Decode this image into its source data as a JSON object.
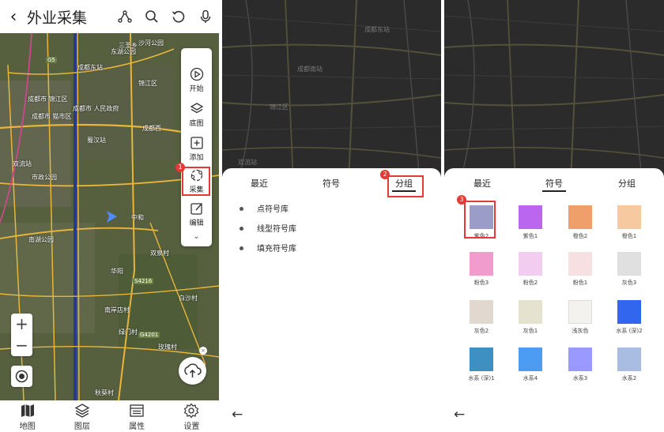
{
  "panel1": {
    "title": "外业采集",
    "map_labels": [
      "东湖公园",
      "沙河公园",
      "成都东站",
      "成都市 人民政府",
      "成都市 锦江区",
      "成都市 猫市区",
      "双流站",
      "市政公园",
      "南湖公园",
      "中和",
      "双泉村",
      "华阳",
      "白沙村",
      "三圣乡",
      "玫瑰村",
      "南岸店村",
      "秋葵村",
      "绿门村",
      "锦江区",
      "成都西",
      "蜀汉站"
    ],
    "road_tags": [
      "G5",
      "S4216",
      "G4201"
    ],
    "tools": [
      "开始",
      "底图",
      "添加",
      "采集",
      "编辑"
    ],
    "badge": "1",
    "zoom_in": "+",
    "zoom_out": "−",
    "close": "×",
    "nav": [
      "地图",
      "图层",
      "属性",
      "设置"
    ]
  },
  "panel2": {
    "tabs": [
      "最近",
      "符号",
      "分组"
    ],
    "active_tab": "分组",
    "badge": "2",
    "libraries": [
      "点符号库",
      "线型符号库",
      "填充符号库"
    ],
    "back": "←",
    "map_labels": [
      "成都东站",
      "成都南站",
      "锦江区",
      "双流站"
    ]
  },
  "panel3": {
    "tabs": [
      "最近",
      "符号",
      "分组"
    ],
    "active_tab": "符号",
    "badge": "3",
    "back": "←",
    "swatches": [
      {
        "name": "紫色2",
        "color": "#9c9cc8"
      },
      {
        "name": "紫色1",
        "color": "#bb66ee"
      },
      {
        "name": "橙色2",
        "color": "#ef9f6a"
      },
      {
        "name": "橙色1",
        "color": "#f6c9a0"
      },
      {
        "name": "粉色3",
        "color": "#f09ccc"
      },
      {
        "name": "粉色2",
        "color": "#f3cdf0"
      },
      {
        "name": "粉色1",
        "color": "#f6e0e2"
      },
      {
        "name": "灰色3",
        "color": "#e0e0e0"
      },
      {
        "name": "灰色2",
        "color": "#e1d9d0"
      },
      {
        "name": "灰色1",
        "color": "#e6e2d0"
      },
      {
        "name": "浅灰色",
        "color": "#f4f2ef"
      },
      {
        "name": "水系 (深)2",
        "color": "#3366ee"
      },
      {
        "name": "水系 (深)1",
        "color": "#3e8fc2"
      },
      {
        "name": "水系4",
        "color": "#4d9cf4"
      },
      {
        "name": "水系3",
        "color": "#9999ff"
      },
      {
        "name": "水系2",
        "color": "#a9bde3"
      }
    ]
  },
  "colors": {
    "highlight": "#e53935",
    "toolbar_bg": "#ffffff",
    "dark_map": "#2b2b2b"
  }
}
